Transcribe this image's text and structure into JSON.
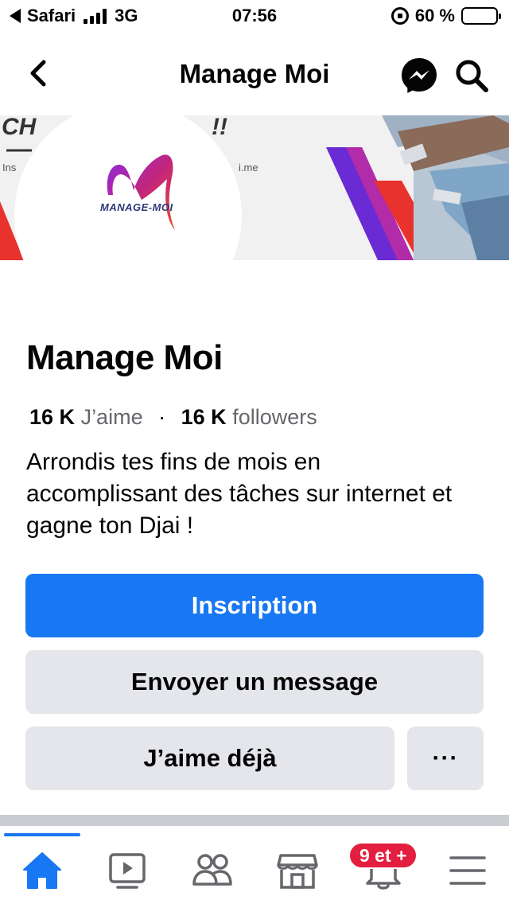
{
  "status_bar": {
    "carrier": "Safari",
    "network": "3G",
    "time": "07:56",
    "battery": "60 %",
    "battery_level": 0.6
  },
  "header": {
    "title": "Manage Moi",
    "back_icon": "chevron-left-icon",
    "messenger_icon": "messenger-icon",
    "search_icon": "search-icon"
  },
  "cover": {
    "text_fragment_1": "CH",
    "text_fragment_2": "!!",
    "text_fragment_3": "Ins",
    "text_fragment_4": "i.me",
    "logo_text": "MANAGE-MOI"
  },
  "page": {
    "name": "Manage Moi",
    "likes_count": "16 K",
    "likes_label": "J’aime",
    "separator": "·",
    "followers_count": "16 K",
    "followers_label": "followers",
    "bio": "Arrondis tes fins de mois en accomplissant des tâches sur internet et gagne ton Djai !"
  },
  "buttons": {
    "primary": "Inscription",
    "message": "Envoyer un message",
    "like": "J’aime déjà",
    "more": "···"
  },
  "tabbar": {
    "tabs": [
      {
        "icon": "home-icon",
        "active": true
      },
      {
        "icon": "video-icon",
        "active": false
      },
      {
        "icon": "groups-icon",
        "active": false
      },
      {
        "icon": "marketplace-icon",
        "active": false
      },
      {
        "icon": "notifications-icon",
        "active": false
      },
      {
        "icon": "menu-icon",
        "active": false
      }
    ],
    "notification_badge": "9 et +"
  },
  "colors": {
    "accent": "#1877f2",
    "secondary_button": "#e4e6eb",
    "badge": "#e41e3f",
    "muted_text": "#65676b"
  }
}
